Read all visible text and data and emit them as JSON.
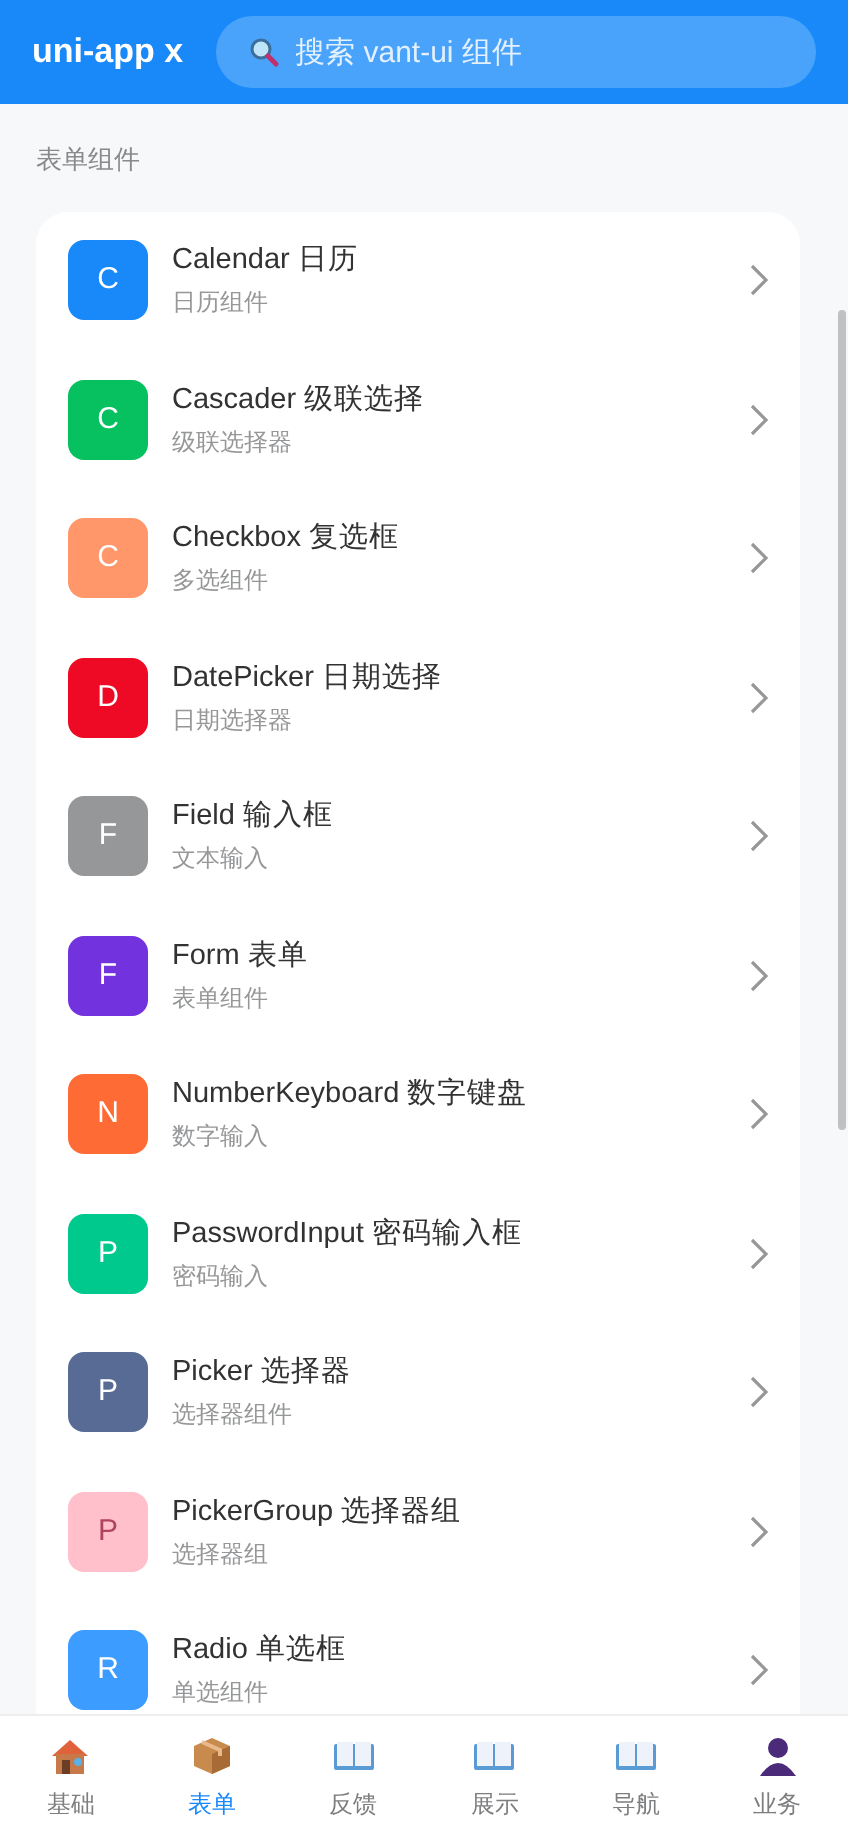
{
  "header": {
    "title": "uni-app x",
    "search": {
      "placeholder": "搜索 vant-ui 组件"
    }
  },
  "section": {
    "title": "表单组件"
  },
  "items": [
    {
      "letter": "C",
      "title": "Calendar 日历",
      "subtitle": "日历组件",
      "color": "#1989fa"
    },
    {
      "letter": "C",
      "title": "Cascader 级联选择",
      "subtitle": "级联选择器",
      "color": "#07c160"
    },
    {
      "letter": "C",
      "title": "Checkbox 复选框",
      "subtitle": "多选组件",
      "color": "#ff976a"
    },
    {
      "letter": "D",
      "title": "DatePicker 日期选择",
      "subtitle": "日期选择器",
      "color": "#ee0a24"
    },
    {
      "letter": "F",
      "title": "Field 输入框",
      "subtitle": "文本输入",
      "color": "#969799"
    },
    {
      "letter": "F",
      "title": "Form 表单",
      "subtitle": "表单组件",
      "color": "#7232dd"
    },
    {
      "letter": "N",
      "title": "NumberKeyboard 数字键盘",
      "subtitle": "数字输入",
      "color": "#ff6b35"
    },
    {
      "letter": "P",
      "title": "PasswordInput 密码输入框",
      "subtitle": "密码输入",
      "color": "#00c98d"
    },
    {
      "letter": "P",
      "title": "Picker 选择器",
      "subtitle": "选择器组件",
      "color": "#576b95"
    },
    {
      "letter": "P",
      "title": "PickerGroup 选择器组",
      "subtitle": "选择器组",
      "color": "#ffc0cb"
    },
    {
      "letter": "R",
      "title": "Radio 单选框",
      "subtitle": "单选组件",
      "color": "#3c9cff"
    }
  ],
  "tabs": [
    {
      "label": "基础",
      "kind": "house",
      "selected": false
    },
    {
      "label": "表单",
      "kind": "box",
      "selected": true
    },
    {
      "label": "反馈",
      "kind": "book",
      "selected": false
    },
    {
      "label": "展示",
      "kind": "book",
      "selected": false
    },
    {
      "label": "导航",
      "kind": "book",
      "selected": false
    },
    {
      "label": "业务",
      "kind": "person",
      "selected": false
    }
  ]
}
